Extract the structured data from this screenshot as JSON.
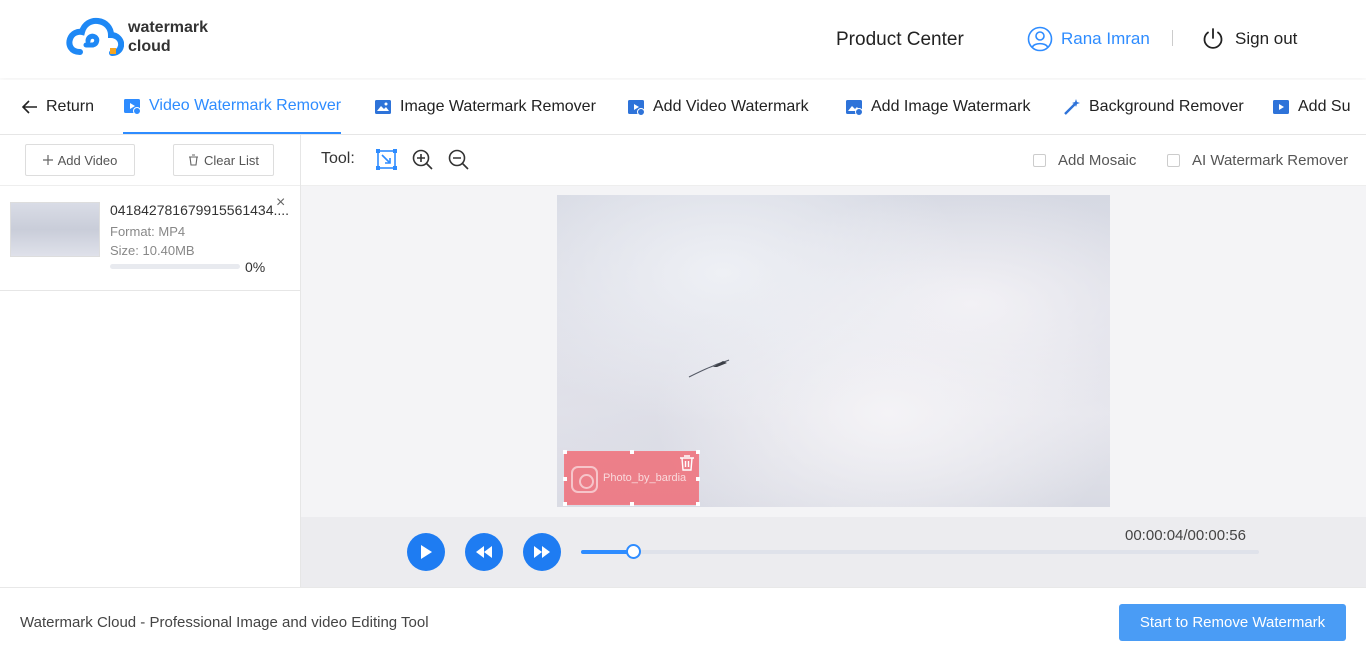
{
  "header": {
    "logo_line1": "watermark",
    "logo_line2": "cloud",
    "product_center": "Product Center",
    "user_name": "Rana Imran",
    "sign_out": "Sign out"
  },
  "tabs": {
    "return": "Return",
    "items": [
      {
        "label": "Video Watermark Remover",
        "active": true,
        "icon": "video-icon"
      },
      {
        "label": "Image Watermark Remover",
        "active": false,
        "icon": "image-icon"
      },
      {
        "label": "Add Video Watermark",
        "active": false,
        "icon": "video-add-icon"
      },
      {
        "label": "Add Image Watermark",
        "active": false,
        "icon": "image-add-icon"
      },
      {
        "label": "Background Remover",
        "active": false,
        "icon": "magic-wand-icon"
      },
      {
        "label": "Add Su",
        "active": false,
        "icon": "subtitle-icon"
      }
    ]
  },
  "left_panel": {
    "add_video": "Add Video",
    "clear_list": "Clear List",
    "files": [
      {
        "name": "04184278167991556143​4....",
        "format_label": "Format:",
        "format": "MP4",
        "size_label": "Size:",
        "size": "10.40MB",
        "progress": "0%"
      }
    ]
  },
  "toolbar": {
    "tool_label": "Tool:",
    "add_mosaic": "Add Mosaic",
    "ai_remover": "AI Watermark Remover"
  },
  "preview": {
    "watermark_text": "Photo_by_bardia"
  },
  "player": {
    "timecode": "00:00:04/00:00:56",
    "progress": 0.077
  },
  "footer": {
    "tagline": "Watermark Cloud - Professional Image and video Editing Tool",
    "start_button": "Start to Remove Watermark"
  },
  "colors": {
    "accent": "#2e8cff",
    "play_button": "#1e7cf2",
    "watermark_selection": "#f25f69",
    "start_button": "#4a9cf5"
  }
}
